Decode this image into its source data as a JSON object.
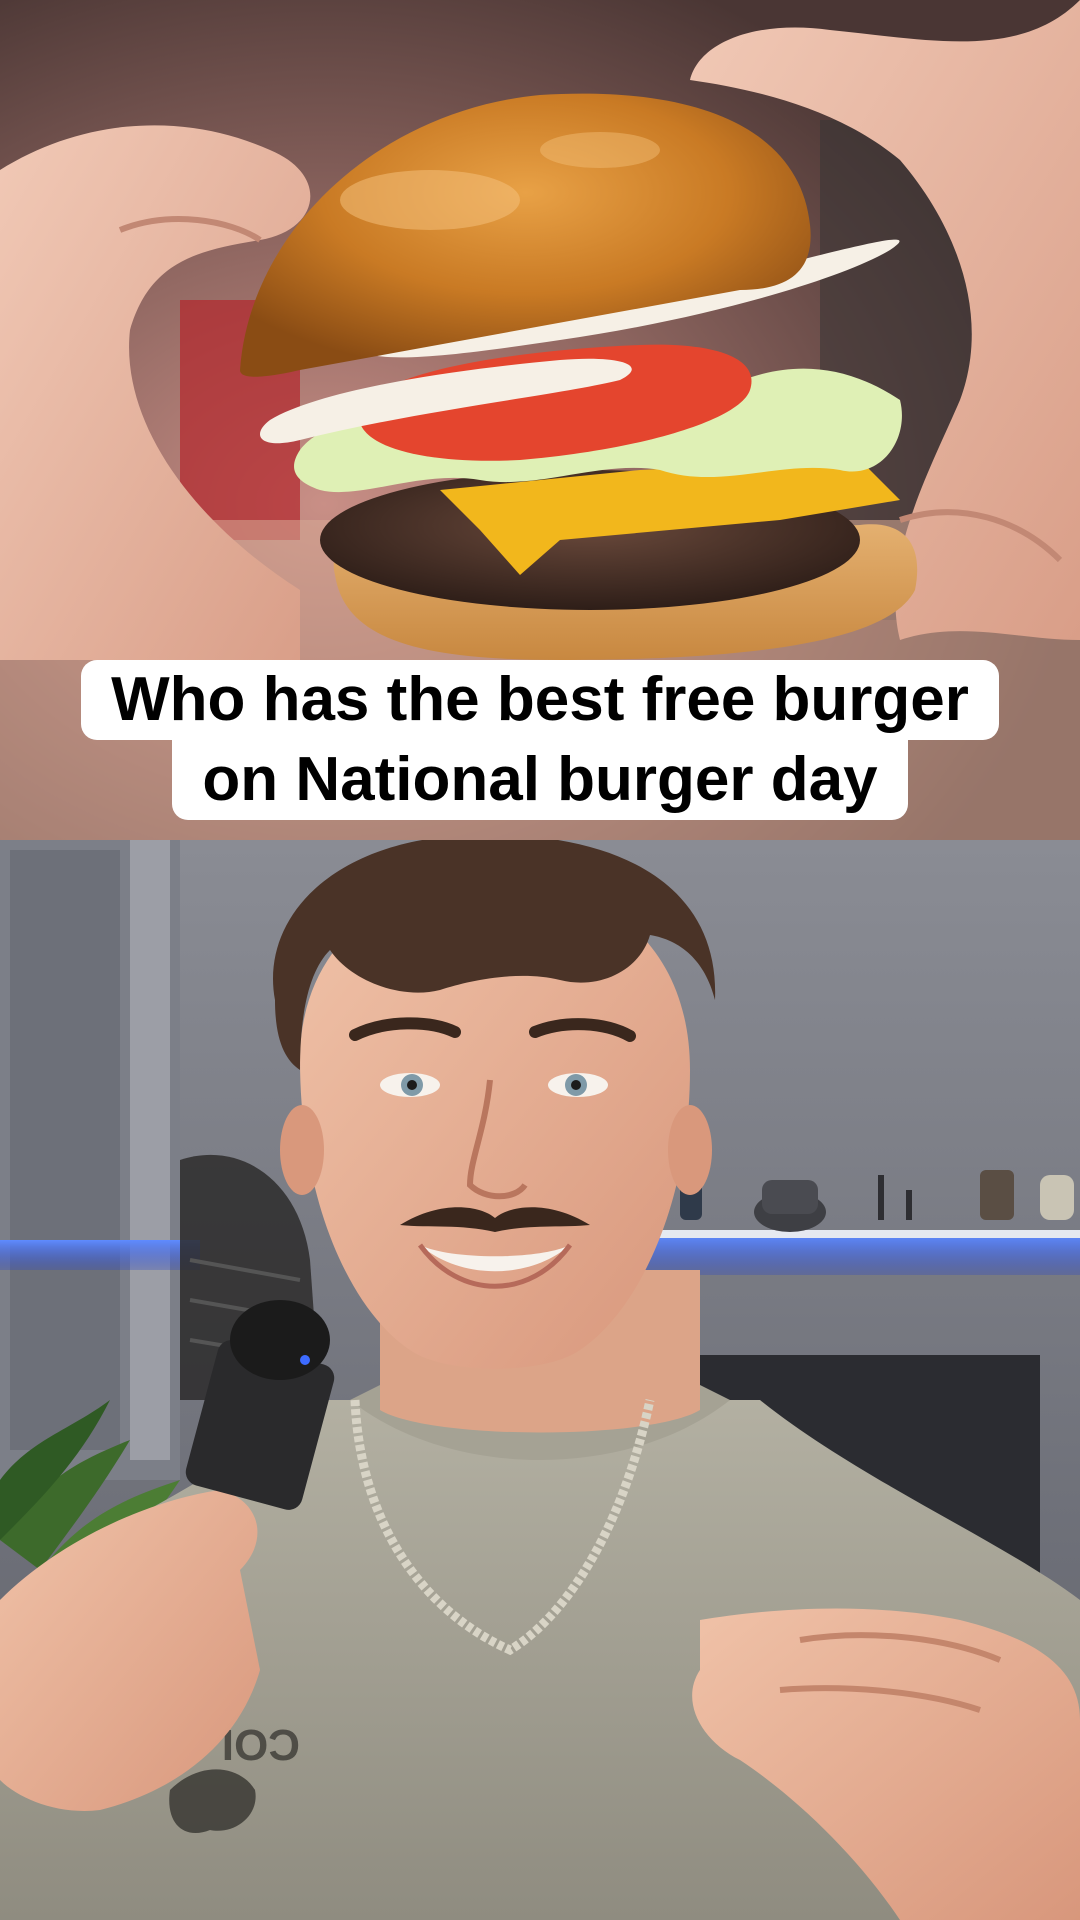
{
  "caption": {
    "line1": "Who has the best free burger",
    "line2": "on National burger day"
  },
  "scene": {
    "top_image": "burger-held-in-hands",
    "bottom_image": "presenter-talking-to-camera",
    "shirt_print": "COLO"
  },
  "colors": {
    "caption_bg": "#ffffff",
    "caption_text": "#000000",
    "led_strip": "#3d6bff"
  }
}
